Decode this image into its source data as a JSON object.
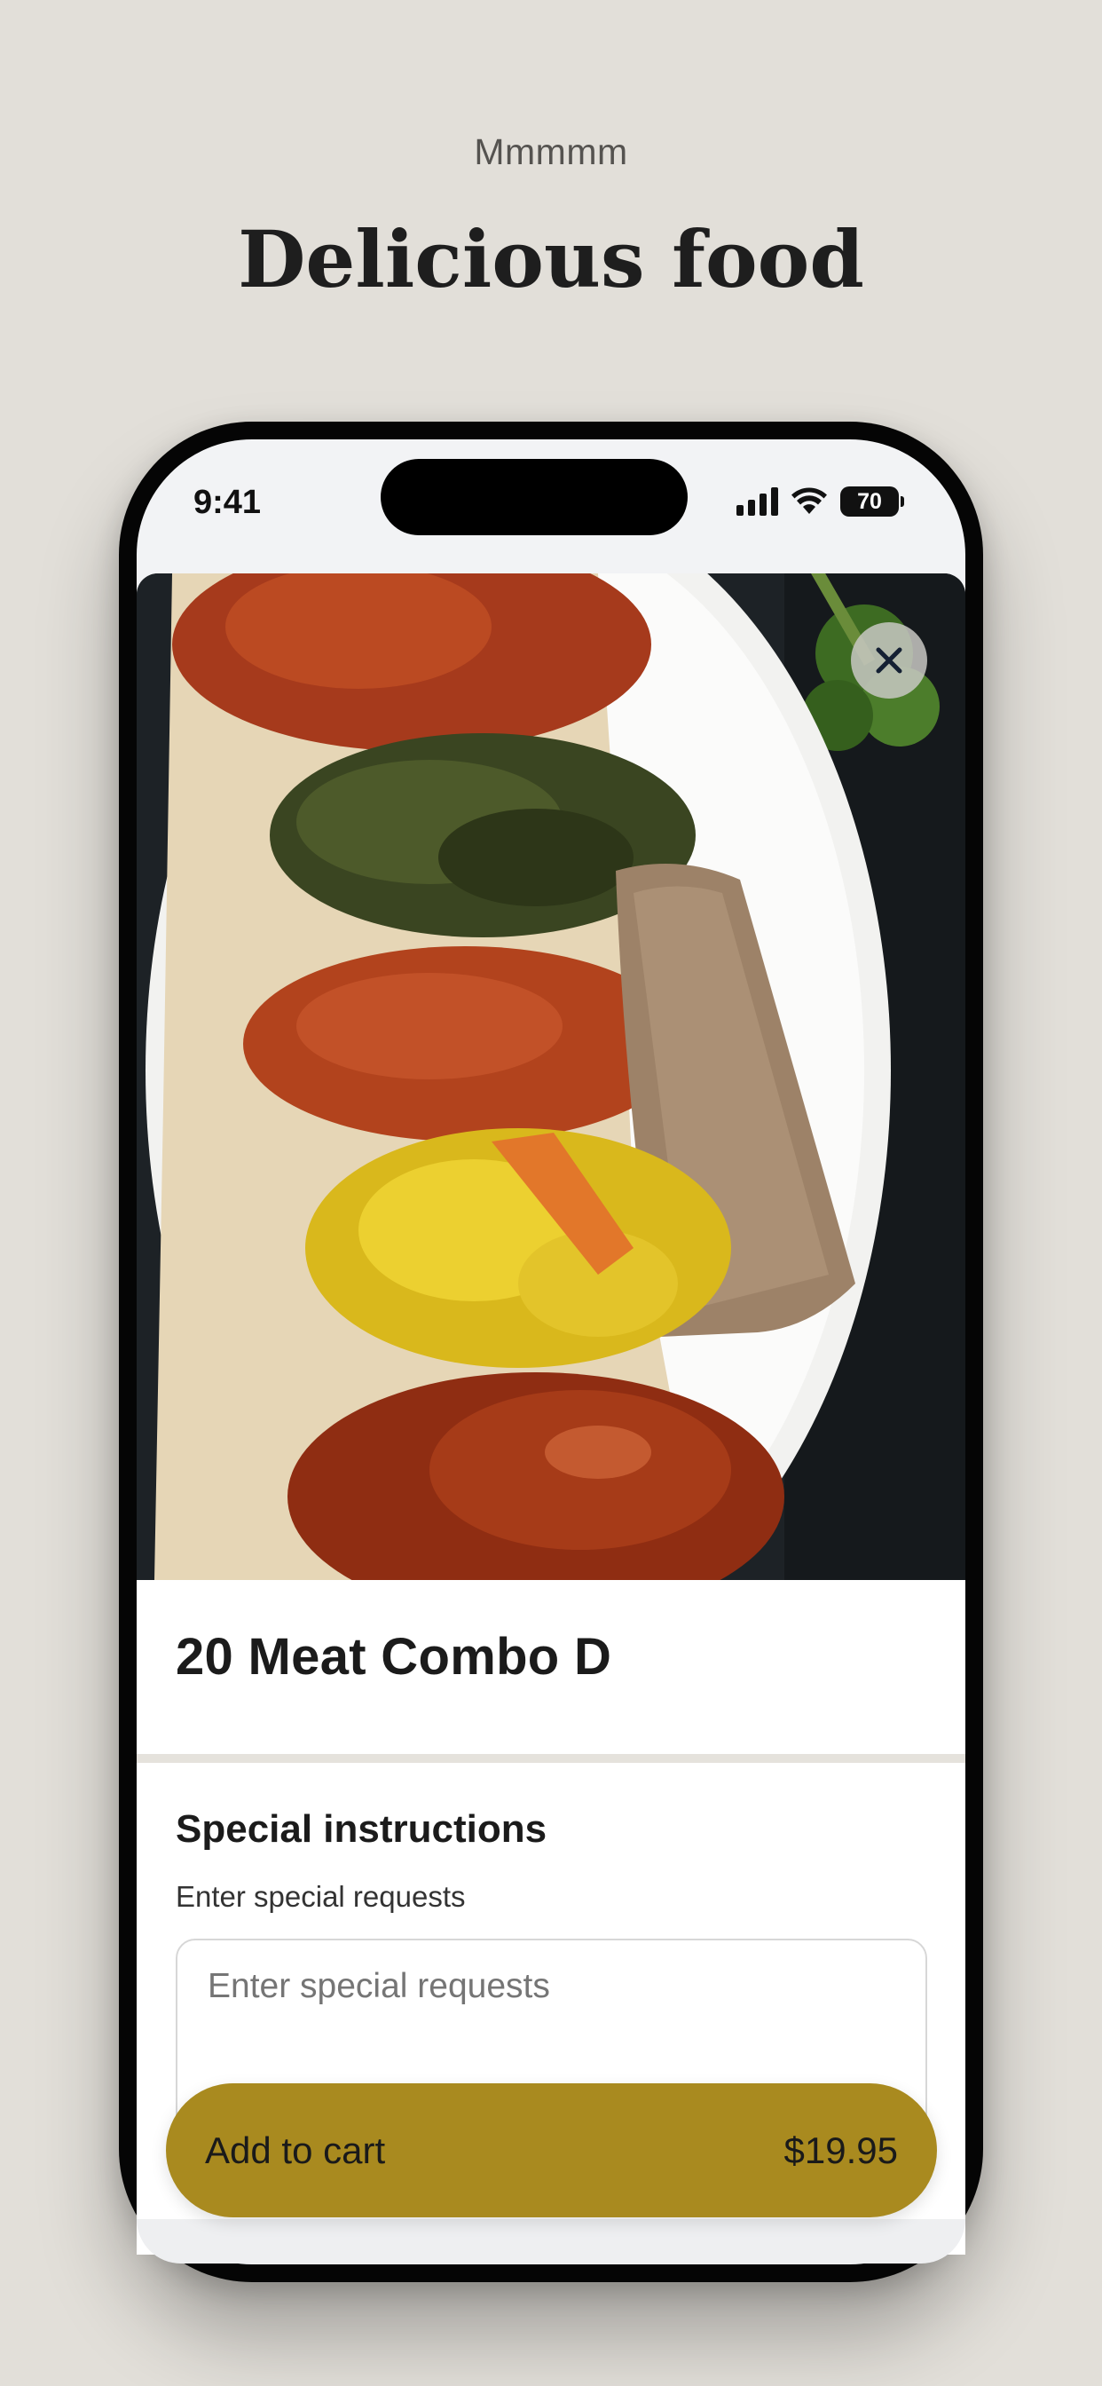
{
  "header": {
    "eyebrow": "Mmmmm",
    "headline": "Delicious food"
  },
  "status_bar": {
    "time": "9:41",
    "battery": "70",
    "icons": [
      "signal-icon",
      "wifi-icon",
      "battery-icon"
    ]
  },
  "item": {
    "image_alt": "Plate of Ethiopian combo dishes on injera",
    "title": "20 Meat Combo D",
    "close_icon": "close-icon"
  },
  "special_instructions": {
    "title": "Special instructions",
    "subtitle": "Enter special requests",
    "placeholder": "Enter special requests",
    "value": ""
  },
  "cart_button": {
    "label": "Add to cart",
    "price": "$19.95",
    "color": "#a98a1f"
  },
  "colors": {
    "background": "#e2dfd9",
    "accent": "#a98a1f"
  }
}
